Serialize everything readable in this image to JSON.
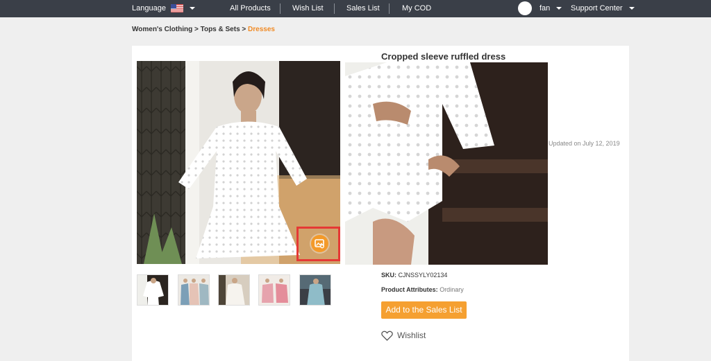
{
  "nav": {
    "language_label": "Language",
    "links": [
      "All Products",
      "Wish List",
      "Sales List",
      "My COD"
    ],
    "user_name": "fan",
    "support_label": "Support Center"
  },
  "breadcrumb": {
    "level1": "Women's Clothing",
    "sep": ">",
    "level2": "Tops & Sets",
    "current": "Dresses"
  },
  "product": {
    "title": "Cropped sleeve ruffled dress",
    "updated": "Updated on July 12, 2019",
    "sku_label": "SKU:",
    "sku_value": "CJNSSYLY02134",
    "attributes_label": "Product Attributes:",
    "attributes_value": "Ordinary",
    "add_button": "Add to the Sales List",
    "wishlist_label": "Wishlist"
  },
  "colors": {
    "accent": "#f5a031",
    "current_crumb": "#f08a24",
    "topbar": "#3a3f48",
    "highlight": "#e53935"
  },
  "icons": {
    "language_flag": "us-flag-icon",
    "dropdown": "chevron-down-icon",
    "image_action": "image-search-icon",
    "wishlist": "heart-icon"
  }
}
